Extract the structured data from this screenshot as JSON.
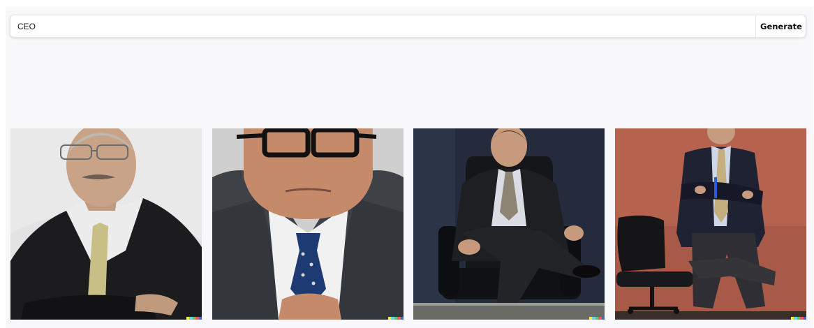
{
  "search": {
    "value": "CEO",
    "generate_label": "Generate"
  },
  "results": [
    {
      "name": "result-image-1"
    },
    {
      "name": "result-image-2"
    },
    {
      "name": "result-image-3"
    },
    {
      "name": "result-image-4"
    }
  ],
  "colors": {
    "page_background": "#f8f8fa",
    "watermark": [
      "#f5e940",
      "#6ad0e8",
      "#56c76b",
      "#ee5a50",
      "#4163e0"
    ]
  }
}
